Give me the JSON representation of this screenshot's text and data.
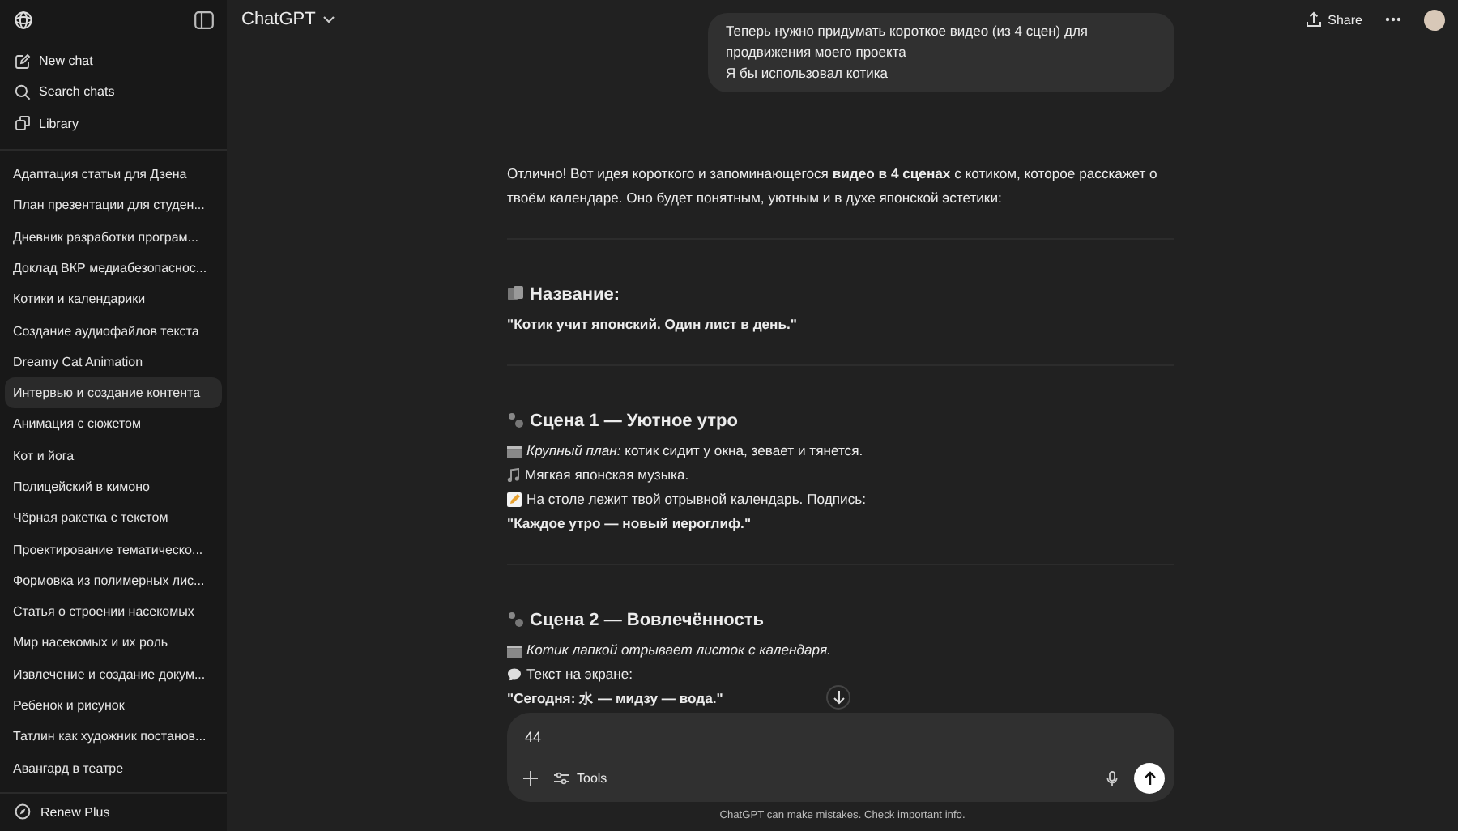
{
  "sidebar": {
    "actions": [
      {
        "kind": "new",
        "label": "New chat"
      },
      {
        "kind": "search",
        "label": "Search chats"
      },
      {
        "kind": "library",
        "label": "Library"
      }
    ],
    "chats": [
      {
        "title": "Адаптация статьи для Дзена",
        "selected": false
      },
      {
        "title": "План презентации для студен...",
        "selected": false
      },
      {
        "title": "Дневник разработки програм...",
        "selected": false
      },
      {
        "title": "Доклад ВКР медиабезопаснос...",
        "selected": false
      },
      {
        "title": "Котики и календарики",
        "selected": false
      },
      {
        "title": "Создание аудиофайлов текста",
        "selected": false
      },
      {
        "title": "Dreamy Cat Animation",
        "selected": false
      },
      {
        "title": "Интервью и создание контента",
        "selected": true
      },
      {
        "title": "Анимация с сюжетом",
        "selected": false
      },
      {
        "title": "Кот и йога",
        "selected": false
      },
      {
        "title": "Полицейский в кимоно",
        "selected": false
      },
      {
        "title": "Чёрная ракетка с текстом",
        "selected": false
      },
      {
        "title": "Проектирование тематическо...",
        "selected": false
      },
      {
        "title": "Формовка из полимерных лис...",
        "selected": false
      },
      {
        "title": "Статья о строении насекомых",
        "selected": false
      },
      {
        "title": "Мир насекомых и их роль",
        "selected": false
      },
      {
        "title": "Извлечение и создание докум...",
        "selected": false
      },
      {
        "title": "Ребенок и рисунок",
        "selected": false
      },
      {
        "title": "Татлин как художник постанов...",
        "selected": false
      },
      {
        "title": "Авангард в театре",
        "selected": false
      }
    ],
    "footer": {
      "label": "Renew Plus"
    }
  },
  "header": {
    "title": "ChatGPT",
    "share": "Share"
  },
  "user_message": "Теперь нужно придумать короткое видео (из 4 сцен) для продвижения моего проекта\nЯ бы использовал котика",
  "reply": {
    "intro": "Отлично! Вот идея короткого и запоминающегося **видео в 4 сценах** с котиком, которое расскажет о твоём календаре. Оно будет понятным, уютным и в духе японской эстетики:",
    "sections": [
      {
        "kind": "title",
        "heading": "Название:",
        "lines": [
          {
            "kind": "quote",
            "text": "\"Котик учит японский. Один лист в день.\""
          }
        ]
      },
      {
        "kind": "scene",
        "heading": "Сцена 1 — Уютное утро",
        "lines": [
          {
            "kind": "shot",
            "text": "*Крупный план:* котик сидит у окна, зевает и тянется."
          },
          {
            "kind": "music",
            "text": "Мягкая японская музыка."
          },
          {
            "kind": "memo",
            "text": "На столе лежит твой отрывной календарь. Подпись:"
          },
          {
            "kind": "quote",
            "text": "\"Каждое утро — новый иероглиф.\""
          }
        ]
      },
      {
        "kind": "scene",
        "heading": "Сцена 2 — Вовлечённость",
        "lines": [
          {
            "kind": "direction",
            "text": "Котик лапкой отрывает листок с календаря."
          },
          {
            "kind": "speech",
            "text": "Текст на экране:"
          },
          {
            "kind": "quote",
            "text": "\"Сегодня: 水 — мидзу — вода.\""
          }
        ]
      }
    ]
  },
  "composer": {
    "value": "44",
    "tools": "Tools"
  },
  "disclaimer": "ChatGPT can make mistakes. Check important info."
}
